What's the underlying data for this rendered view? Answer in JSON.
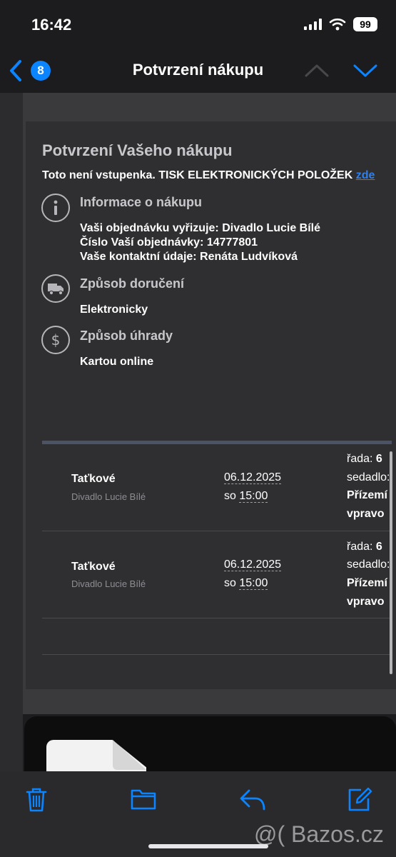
{
  "status_bar": {
    "time": "16:42",
    "battery": "99",
    "icons": [
      "signal-icon",
      "wifi-icon",
      "battery-icon"
    ]
  },
  "nav": {
    "unread_count": "8",
    "title": "Potvrzení nákupu",
    "icons": [
      "back-chevron-icon",
      "up-arrow-icon",
      "down-arrow-icon"
    ]
  },
  "email": {
    "heading": "Potvrzení Vašeho nákupu",
    "notice_text": "Toto není vstupenka. TISK ELEKTRONICKÝCH POLOŽEK",
    "notice_link": "zde",
    "purchase_info": {
      "title": "Informace o nákupu",
      "lines": [
        "Vaši objednávku vyřizuje: Divadlo Lucie Bílé",
        "Číslo Vaší objednávky: 14777801",
        "Vaše kontaktní údaje: Renáta Ludvíková"
      ]
    },
    "delivery": {
      "title": "Způsob doručení",
      "value": "Elektronicky"
    },
    "payment": {
      "title": "Způsob úhrady",
      "value": "Kartou online"
    },
    "tickets": [
      {
        "name": "Taťkové",
        "venue": "Divadlo Lucie Bílé",
        "date": "06.12.2025",
        "day": "so",
        "time": "15:00",
        "row_label": "řada:",
        "row": "6",
        "seat_label": "sedadlo:",
        "location_1": "Přízemí",
        "location_2": "vpravo"
      },
      {
        "name": "Taťkové",
        "venue": "Divadlo Lucie Bílé",
        "date": "06.12.2025",
        "day": "so",
        "time": "15:00",
        "row_label": "řada:",
        "row": "6",
        "seat_label": "sedadlo:",
        "location_1": "Přízemí",
        "location_2": "vpravo"
      }
    ]
  },
  "toolbar": {
    "icons": [
      "trash-icon",
      "folder-icon",
      "reply-icon",
      "compose-icon"
    ]
  },
  "watermark": "@( Bazos.cz",
  "colors": {
    "accent": "#0a84ff",
    "background": "#1c1c1e",
    "card": "#2f2f31",
    "link": "#2f80ed"
  }
}
